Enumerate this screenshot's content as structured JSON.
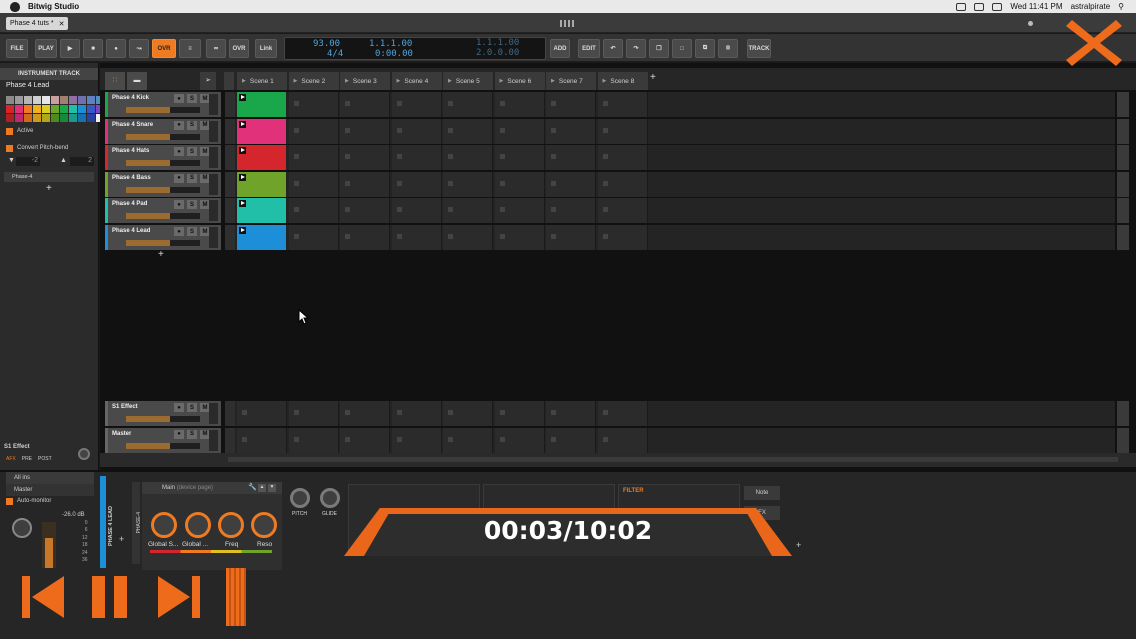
{
  "menubar": {
    "app_name": "Bitwig Studio",
    "clock": "Wed 11:41 PM",
    "user": "astralpirate"
  },
  "document_tab": {
    "label": "Phase 4 tuts *"
  },
  "transport": {
    "file": "FILE",
    "play_label": "PLAY",
    "ovr": "OVR",
    "ovr2": "OVR",
    "link": "Link",
    "tempo": "93.00",
    "time_sig": "4/4",
    "position": "1.1.1.00",
    "time": "0:00.00",
    "loop_start": "1.1.1.00",
    "loop_len": "2.0.0.00",
    "add": "ADD",
    "edit": "EDIT",
    "track": "TRACK"
  },
  "inspector": {
    "title": "INSTRUMENT TRACK",
    "track_name": "Phase 4 Lead",
    "active": "Active",
    "convert": "Convert Pitch-bend",
    "pitch_down": "-2",
    "pitch_up": "2",
    "device": "Phase-4",
    "effect_name": "S1 Effect",
    "tabs": [
      "AFX",
      "PRE",
      "POST"
    ],
    "routing_in": "All ins",
    "routing_out": "Master",
    "auto_monitor": "Auto-monitor",
    "level": "-26.0 dB",
    "meter_scale": [
      "0",
      "6",
      "12",
      "18",
      "24",
      "36"
    ]
  },
  "scenes": [
    "Scene 1",
    "Scene 2",
    "Scene 3",
    "Scene 4",
    "Scene 5",
    "Scene 6",
    "Scene 7",
    "Scene 8"
  ],
  "tracks": [
    {
      "name": "Phase 4 Kick",
      "color": "#1aa64a"
    },
    {
      "name": "Phase 4 Snare",
      "color": "#e0317a"
    },
    {
      "name": "Phase 4 Hats",
      "color": "#d5252d"
    },
    {
      "name": "Phase 4 Bass",
      "color": "#6fa32a"
    },
    {
      "name": "Phase 4 Pad",
      "color": "#22bfa8"
    },
    {
      "name": "Phase 4 Lead",
      "color": "#1d8ed8"
    }
  ],
  "fx_tracks": [
    {
      "name": "S1 Effect"
    },
    {
      "name": "Master"
    }
  ],
  "device_panel": {
    "title": "Main",
    "subtitle": "(device page)",
    "macros": [
      "Global S...",
      "Global ...",
      "Freq",
      "Reso"
    ],
    "track_label": "PHASE 4 LEAD",
    "device_label": "PHASE-4",
    "pitch": "PITCH",
    "glide": "GLIDE",
    "filter": "FILTER",
    "note": "Note",
    "fx": "FX"
  },
  "video": {
    "timecode": "00:03/10:02"
  },
  "colors": {
    "accent": "#ee7b22",
    "overlay": "#e9661b"
  }
}
